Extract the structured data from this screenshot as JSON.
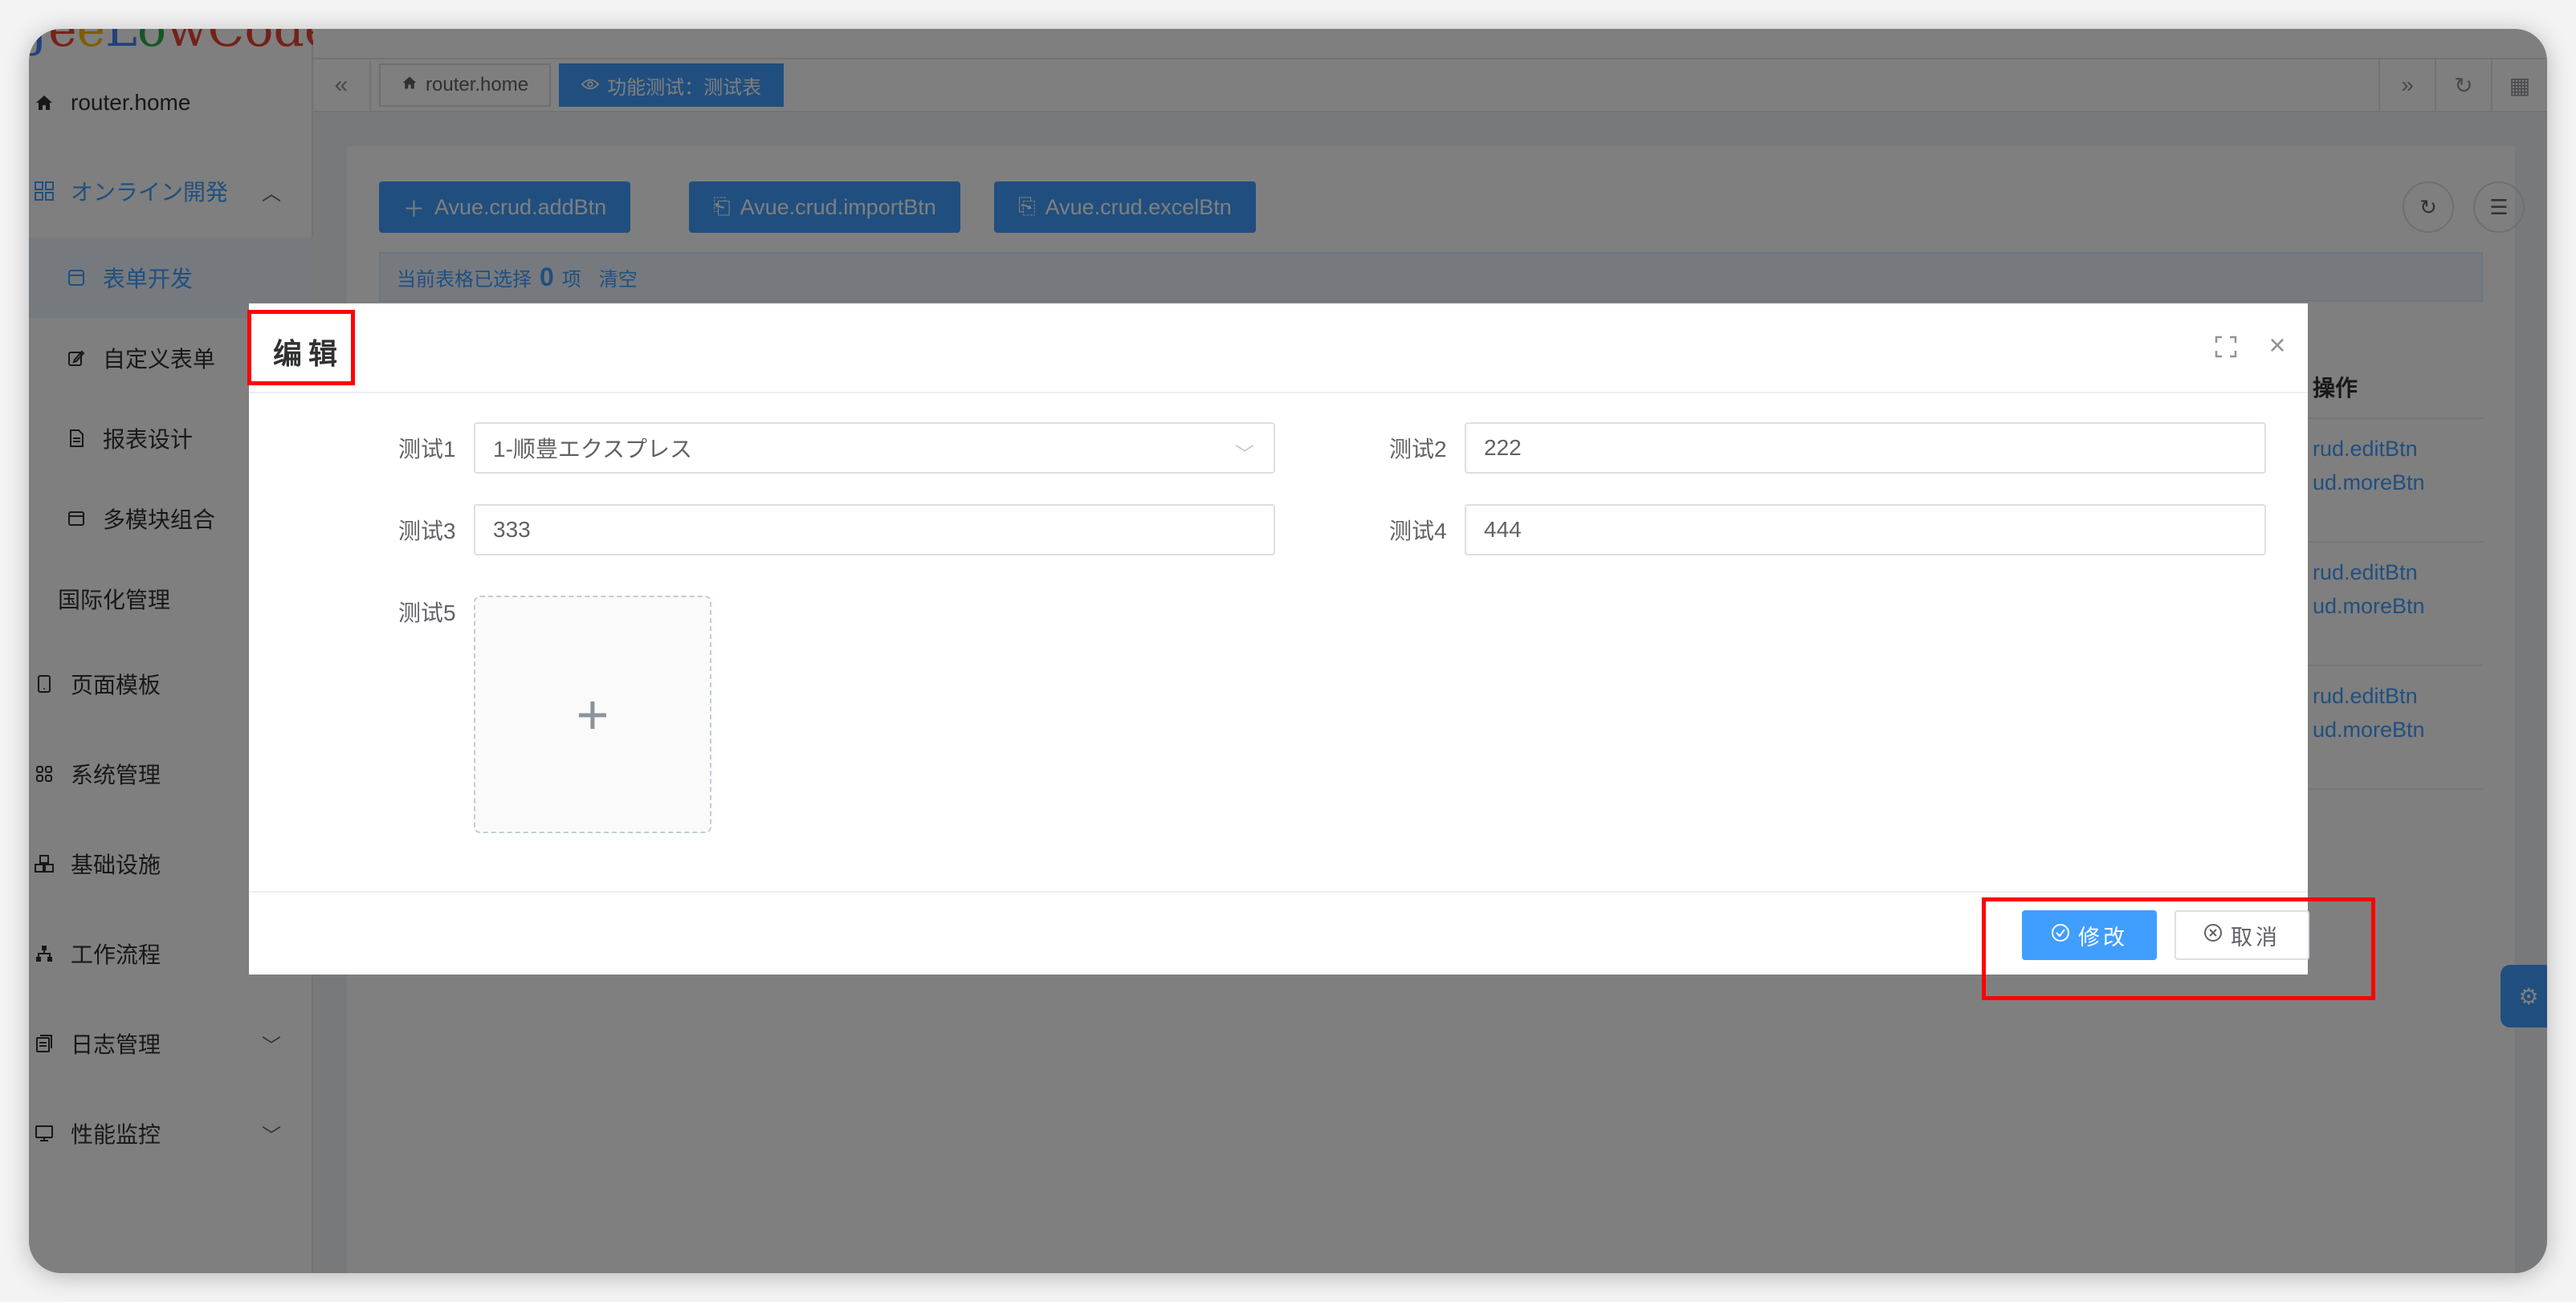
{
  "sidebar": {
    "logo": [
      "J",
      "e",
      "e",
      "L",
      "o",
      "wCode"
    ],
    "items": [
      {
        "label": "router.home"
      },
      {
        "label": "オンライン開発",
        "arrow": "^"
      },
      {
        "label": "表单开发"
      },
      {
        "label": "自定义表单"
      },
      {
        "label": "报表设计"
      },
      {
        "label": "多模块组合"
      },
      {
        "label": "国际化管理"
      },
      {
        "label": "页面模板"
      },
      {
        "label": "系统管理"
      },
      {
        "label": "基础设施"
      },
      {
        "label": "工作流程"
      },
      {
        "label": "日志管理",
        "arrow": "v"
      },
      {
        "label": "性能监控",
        "arrow": "v"
      }
    ]
  },
  "tabs": [
    {
      "label": "router.home"
    },
    {
      "label": "功能测试：测试表"
    }
  ],
  "toolbar": {
    "add": "Avue.crud.addBtn",
    "import": "Avue.crud.importBtn",
    "excel": "Avue.crud.excelBtn"
  },
  "selection": {
    "prefix": "当前表格已选择",
    "count": "0",
    "suffix": "项",
    "clear": "清空"
  },
  "table": {
    "op_header": "操作",
    "rows": [
      {
        "edit": "rud.editBtn",
        "more": "ud.moreBtn"
      },
      {
        "edit": "rud.editBtn",
        "more": "ud.moreBtn"
      },
      {
        "edit": "rud.editBtn",
        "more": "ud.moreBtn"
      }
    ]
  },
  "dialog": {
    "title": "编辑",
    "fields": {
      "f1_label": "测试1",
      "f1_value": "1-顺豊エクスプレス",
      "f2_label": "测试2",
      "f2_value": "222",
      "f3_label": "测试3",
      "f3_value": "333",
      "f4_label": "测试4",
      "f4_value": "444",
      "f5_label": "测试5"
    },
    "submit": "修改",
    "cancel": "取消"
  },
  "colors": {
    "primary": "#409eff",
    "highlight": "#ff0000"
  }
}
